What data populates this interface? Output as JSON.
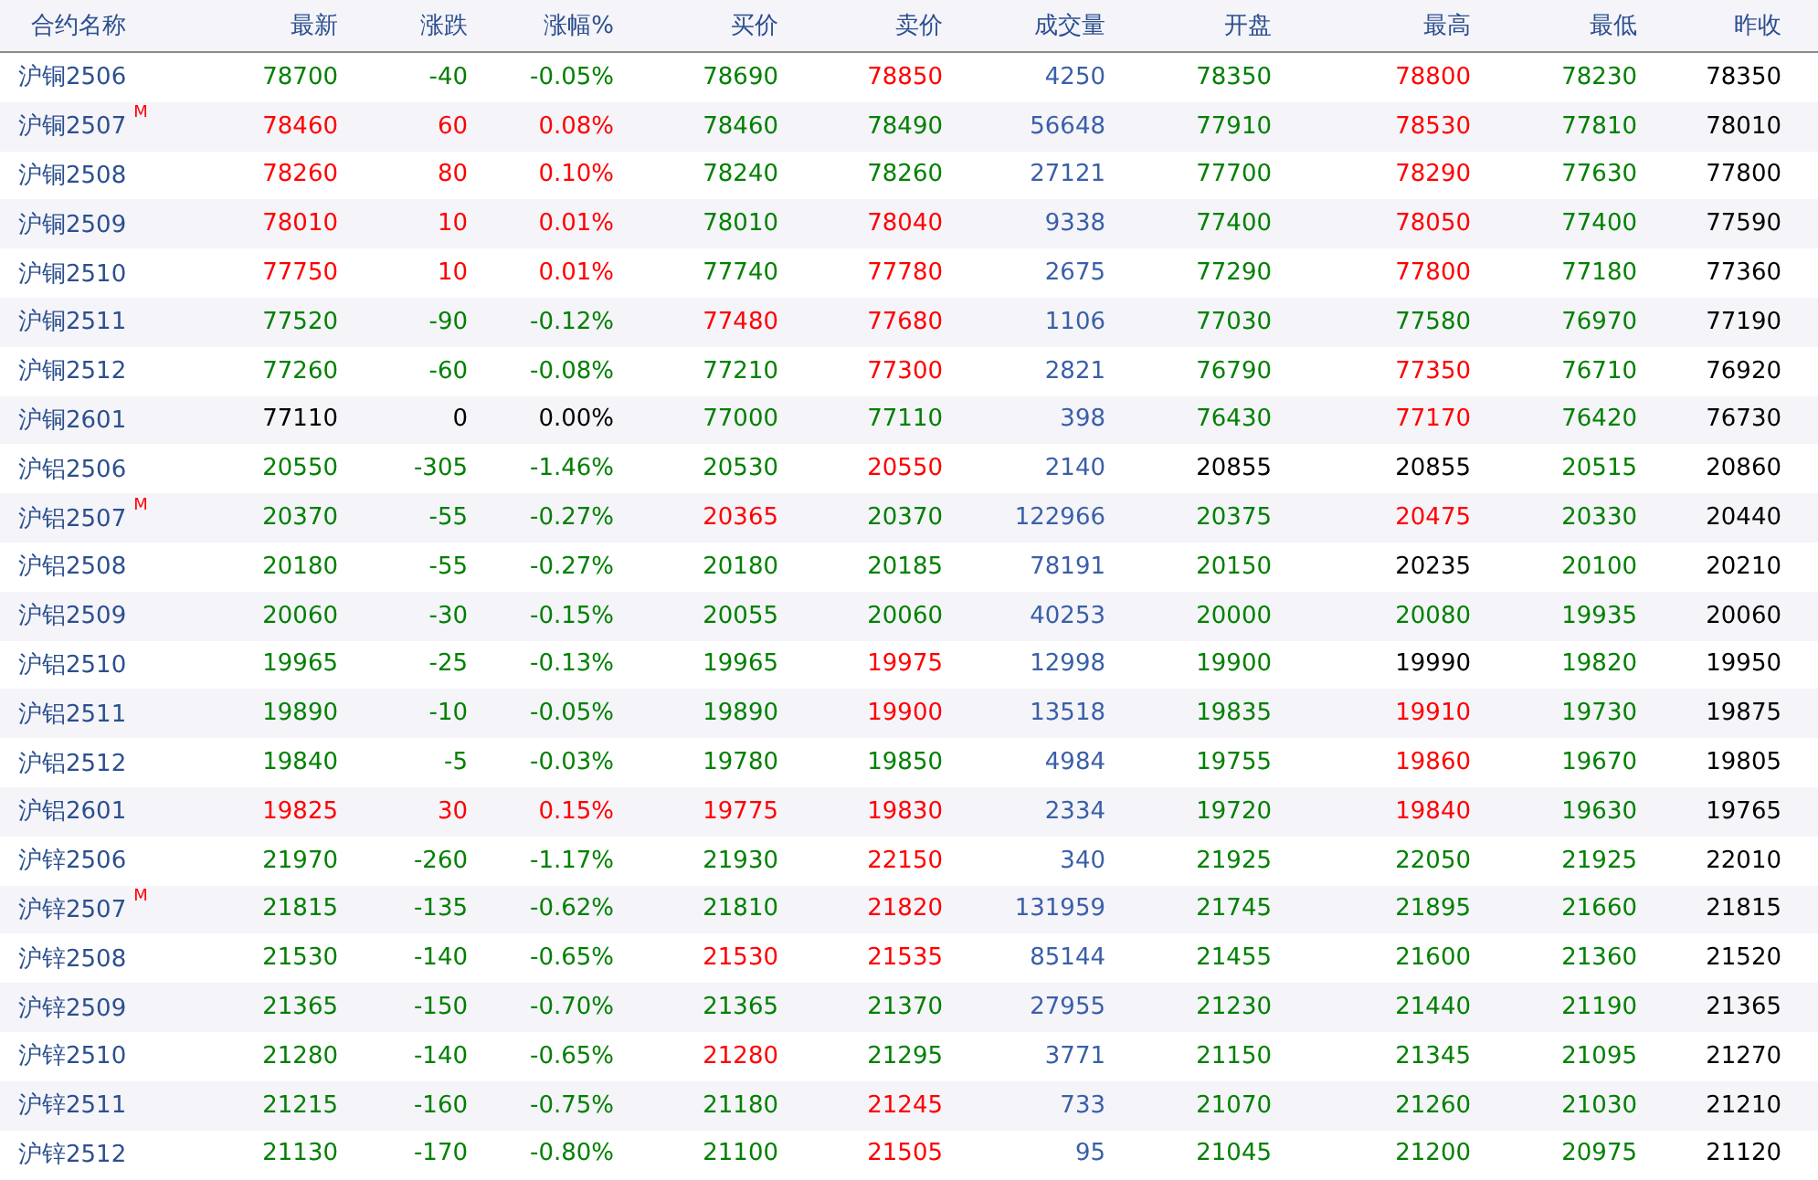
{
  "table": {
    "columns": [
      "合约名称",
      "最新",
      "涨跌",
      "涨幅%",
      "买价",
      "卖价",
      "成交量",
      "开盘",
      "最高",
      "最低",
      "昨收"
    ],
    "rows": [
      {
        "cells": [
          {
            "text": "沪铜2506"
          },
          {
            "text": "78700",
            "color": "#008000"
          },
          {
            "text": "-40",
            "color": "#008000"
          },
          {
            "text": "-0.05%",
            "color": "#008000"
          },
          {
            "text": "78690",
            "color": "#008000"
          },
          {
            "text": "78850",
            "color": "#ff0000"
          },
          {
            "text": "4250",
            "color": "#3a5fa8"
          },
          {
            "text": "78350",
            "color": "#008000"
          },
          {
            "text": "78800",
            "color": "#ff0000"
          },
          {
            "text": "78230",
            "color": "#008000"
          },
          {
            "text": "78350",
            "color": "#000000"
          }
        ]
      },
      {
        "cells": [
          {
            "text": "沪铜2507",
            "badge": "M"
          },
          {
            "text": "78460",
            "color": "#ff0000"
          },
          {
            "text": "60",
            "color": "#ff0000"
          },
          {
            "text": "0.08%",
            "color": "#ff0000"
          },
          {
            "text": "78460",
            "color": "#008000"
          },
          {
            "text": "78490",
            "color": "#008000"
          },
          {
            "text": "56648",
            "color": "#3a5fa8"
          },
          {
            "text": "77910",
            "color": "#008000"
          },
          {
            "text": "78530",
            "color": "#ff0000"
          },
          {
            "text": "77810",
            "color": "#008000"
          },
          {
            "text": "78010",
            "color": "#000000"
          }
        ]
      },
      {
        "cells": [
          {
            "text": "沪铜2508"
          },
          {
            "text": "78260",
            "color": "#ff0000"
          },
          {
            "text": "80",
            "color": "#ff0000"
          },
          {
            "text": "0.10%",
            "color": "#ff0000"
          },
          {
            "text": "78240",
            "color": "#008000"
          },
          {
            "text": "78260",
            "color": "#008000"
          },
          {
            "text": "27121",
            "color": "#3a5fa8"
          },
          {
            "text": "77700",
            "color": "#008000"
          },
          {
            "text": "78290",
            "color": "#ff0000"
          },
          {
            "text": "77630",
            "color": "#008000"
          },
          {
            "text": "77800",
            "color": "#000000"
          }
        ]
      },
      {
        "cells": [
          {
            "text": "沪铜2509"
          },
          {
            "text": "78010",
            "color": "#ff0000"
          },
          {
            "text": "10",
            "color": "#ff0000"
          },
          {
            "text": "0.01%",
            "color": "#ff0000"
          },
          {
            "text": "78010",
            "color": "#008000"
          },
          {
            "text": "78040",
            "color": "#ff0000"
          },
          {
            "text": "9338",
            "color": "#3a5fa8"
          },
          {
            "text": "77400",
            "color": "#008000"
          },
          {
            "text": "78050",
            "color": "#ff0000"
          },
          {
            "text": "77400",
            "color": "#008000"
          },
          {
            "text": "77590",
            "color": "#000000"
          }
        ]
      },
      {
        "cells": [
          {
            "text": "沪铜2510"
          },
          {
            "text": "77750",
            "color": "#ff0000"
          },
          {
            "text": "10",
            "color": "#ff0000"
          },
          {
            "text": "0.01%",
            "color": "#ff0000"
          },
          {
            "text": "77740",
            "color": "#008000"
          },
          {
            "text": "77780",
            "color": "#ff0000"
          },
          {
            "text": "2675",
            "color": "#3a5fa8"
          },
          {
            "text": "77290",
            "color": "#008000"
          },
          {
            "text": "77800",
            "color": "#ff0000"
          },
          {
            "text": "77180",
            "color": "#008000"
          },
          {
            "text": "77360",
            "color": "#000000"
          }
        ]
      },
      {
        "cells": [
          {
            "text": "沪铜2511"
          },
          {
            "text": "77520",
            "color": "#008000"
          },
          {
            "text": "-90",
            "color": "#008000"
          },
          {
            "text": "-0.12%",
            "color": "#008000"
          },
          {
            "text": "77480",
            "color": "#ff0000"
          },
          {
            "text": "77680",
            "color": "#ff0000"
          },
          {
            "text": "1106",
            "color": "#3a5fa8"
          },
          {
            "text": "77030",
            "color": "#008000"
          },
          {
            "text": "77580",
            "color": "#008000"
          },
          {
            "text": "76970",
            "color": "#008000"
          },
          {
            "text": "77190",
            "color": "#000000"
          }
        ]
      },
      {
        "cells": [
          {
            "text": "沪铜2512"
          },
          {
            "text": "77260",
            "color": "#008000"
          },
          {
            "text": "-60",
            "color": "#008000"
          },
          {
            "text": "-0.08%",
            "color": "#008000"
          },
          {
            "text": "77210",
            "color": "#008000"
          },
          {
            "text": "77300",
            "color": "#ff0000"
          },
          {
            "text": "2821",
            "color": "#3a5fa8"
          },
          {
            "text": "76790",
            "color": "#008000"
          },
          {
            "text": "77350",
            "color": "#ff0000"
          },
          {
            "text": "76710",
            "color": "#008000"
          },
          {
            "text": "76920",
            "color": "#000000"
          }
        ]
      },
      {
        "cells": [
          {
            "text": "沪铜2601"
          },
          {
            "text": "77110",
            "color": "#000000"
          },
          {
            "text": "0",
            "color": "#000000"
          },
          {
            "text": "0.00%",
            "color": "#000000"
          },
          {
            "text": "77000",
            "color": "#008000"
          },
          {
            "text": "77110",
            "color": "#008000"
          },
          {
            "text": "398",
            "color": "#3a5fa8"
          },
          {
            "text": "76430",
            "color": "#008000"
          },
          {
            "text": "77170",
            "color": "#ff0000"
          },
          {
            "text": "76420",
            "color": "#008000"
          },
          {
            "text": "76730",
            "color": "#000000"
          }
        ]
      },
      {
        "cells": [
          {
            "text": "沪铝2506"
          },
          {
            "text": "20550",
            "color": "#008000"
          },
          {
            "text": "-305",
            "color": "#008000"
          },
          {
            "text": "-1.46%",
            "color": "#008000"
          },
          {
            "text": "20530",
            "color": "#008000"
          },
          {
            "text": "20550",
            "color": "#ff0000"
          },
          {
            "text": "2140",
            "color": "#3a5fa8"
          },
          {
            "text": "20855",
            "color": "#000000"
          },
          {
            "text": "20855",
            "color": "#000000"
          },
          {
            "text": "20515",
            "color": "#008000"
          },
          {
            "text": "20860",
            "color": "#000000"
          }
        ]
      },
      {
        "cells": [
          {
            "text": "沪铝2507",
            "badge": "M"
          },
          {
            "text": "20370",
            "color": "#008000"
          },
          {
            "text": "-55",
            "color": "#008000"
          },
          {
            "text": "-0.27%",
            "color": "#008000"
          },
          {
            "text": "20365",
            "color": "#ff0000"
          },
          {
            "text": "20370",
            "color": "#008000"
          },
          {
            "text": "122966",
            "color": "#3a5fa8"
          },
          {
            "text": "20375",
            "color": "#008000"
          },
          {
            "text": "20475",
            "color": "#ff0000"
          },
          {
            "text": "20330",
            "color": "#008000"
          },
          {
            "text": "20440",
            "color": "#000000"
          }
        ]
      },
      {
        "cells": [
          {
            "text": "沪铝2508"
          },
          {
            "text": "20180",
            "color": "#008000"
          },
          {
            "text": "-55",
            "color": "#008000"
          },
          {
            "text": "-0.27%",
            "color": "#008000"
          },
          {
            "text": "20180",
            "color": "#008000"
          },
          {
            "text": "20185",
            "color": "#008000"
          },
          {
            "text": "78191",
            "color": "#3a5fa8"
          },
          {
            "text": "20150",
            "color": "#008000"
          },
          {
            "text": "20235",
            "color": "#000000"
          },
          {
            "text": "20100",
            "color": "#008000"
          },
          {
            "text": "20210",
            "color": "#000000"
          }
        ]
      },
      {
        "cells": [
          {
            "text": "沪铝2509"
          },
          {
            "text": "20060",
            "color": "#008000"
          },
          {
            "text": "-30",
            "color": "#008000"
          },
          {
            "text": "-0.15%",
            "color": "#008000"
          },
          {
            "text": "20055",
            "color": "#008000"
          },
          {
            "text": "20060",
            "color": "#008000"
          },
          {
            "text": "40253",
            "color": "#3a5fa8"
          },
          {
            "text": "20000",
            "color": "#008000"
          },
          {
            "text": "20080",
            "color": "#008000"
          },
          {
            "text": "19935",
            "color": "#008000"
          },
          {
            "text": "20060",
            "color": "#000000"
          }
        ]
      },
      {
        "cells": [
          {
            "text": "沪铝2510"
          },
          {
            "text": "19965",
            "color": "#008000"
          },
          {
            "text": "-25",
            "color": "#008000"
          },
          {
            "text": "-0.13%",
            "color": "#008000"
          },
          {
            "text": "19965",
            "color": "#008000"
          },
          {
            "text": "19975",
            "color": "#ff0000"
          },
          {
            "text": "12998",
            "color": "#3a5fa8"
          },
          {
            "text": "19900",
            "color": "#008000"
          },
          {
            "text": "19990",
            "color": "#000000"
          },
          {
            "text": "19820",
            "color": "#008000"
          },
          {
            "text": "19950",
            "color": "#000000"
          }
        ]
      },
      {
        "cells": [
          {
            "text": "沪铝2511"
          },
          {
            "text": "19890",
            "color": "#008000"
          },
          {
            "text": "-10",
            "color": "#008000"
          },
          {
            "text": "-0.05%",
            "color": "#008000"
          },
          {
            "text": "19890",
            "color": "#008000"
          },
          {
            "text": "19900",
            "color": "#ff0000"
          },
          {
            "text": "13518",
            "color": "#3a5fa8"
          },
          {
            "text": "19835",
            "color": "#008000"
          },
          {
            "text": "19910",
            "color": "#ff0000"
          },
          {
            "text": "19730",
            "color": "#008000"
          },
          {
            "text": "19875",
            "color": "#000000"
          }
        ]
      },
      {
        "cells": [
          {
            "text": "沪铝2512"
          },
          {
            "text": "19840",
            "color": "#008000"
          },
          {
            "text": "-5",
            "color": "#008000"
          },
          {
            "text": "-0.03%",
            "color": "#008000"
          },
          {
            "text": "19780",
            "color": "#008000"
          },
          {
            "text": "19850",
            "color": "#008000"
          },
          {
            "text": "4984",
            "color": "#3a5fa8"
          },
          {
            "text": "19755",
            "color": "#008000"
          },
          {
            "text": "19860",
            "color": "#ff0000"
          },
          {
            "text": "19670",
            "color": "#008000"
          },
          {
            "text": "19805",
            "color": "#000000"
          }
        ]
      },
      {
        "cells": [
          {
            "text": "沪铝2601"
          },
          {
            "text": "19825",
            "color": "#ff0000"
          },
          {
            "text": "30",
            "color": "#ff0000"
          },
          {
            "text": "0.15%",
            "color": "#ff0000"
          },
          {
            "text": "19775",
            "color": "#ff0000"
          },
          {
            "text": "19830",
            "color": "#ff0000"
          },
          {
            "text": "2334",
            "color": "#3a5fa8"
          },
          {
            "text": "19720",
            "color": "#008000"
          },
          {
            "text": "19840",
            "color": "#ff0000"
          },
          {
            "text": "19630",
            "color": "#008000"
          },
          {
            "text": "19765",
            "color": "#000000"
          }
        ]
      },
      {
        "cells": [
          {
            "text": "沪锌2506"
          },
          {
            "text": "21970",
            "color": "#008000"
          },
          {
            "text": "-260",
            "color": "#008000"
          },
          {
            "text": "-1.17%",
            "color": "#008000"
          },
          {
            "text": "21930",
            "color": "#008000"
          },
          {
            "text": "22150",
            "color": "#ff0000"
          },
          {
            "text": "340",
            "color": "#3a5fa8"
          },
          {
            "text": "21925",
            "color": "#008000"
          },
          {
            "text": "22050",
            "color": "#008000"
          },
          {
            "text": "21925",
            "color": "#008000"
          },
          {
            "text": "22010",
            "color": "#000000"
          }
        ]
      },
      {
        "cells": [
          {
            "text": "沪锌2507",
            "badge": "M"
          },
          {
            "text": "21815",
            "color": "#008000"
          },
          {
            "text": "-135",
            "color": "#008000"
          },
          {
            "text": "-0.62%",
            "color": "#008000"
          },
          {
            "text": "21810",
            "color": "#008000"
          },
          {
            "text": "21820",
            "color": "#ff0000"
          },
          {
            "text": "131959",
            "color": "#3a5fa8"
          },
          {
            "text": "21745",
            "color": "#008000"
          },
          {
            "text": "21895",
            "color": "#008000"
          },
          {
            "text": "21660",
            "color": "#008000"
          },
          {
            "text": "21815",
            "color": "#000000"
          }
        ]
      },
      {
        "cells": [
          {
            "text": "沪锌2508"
          },
          {
            "text": "21530",
            "color": "#008000"
          },
          {
            "text": "-140",
            "color": "#008000"
          },
          {
            "text": "-0.65%",
            "color": "#008000"
          },
          {
            "text": "21530",
            "color": "#ff0000"
          },
          {
            "text": "21535",
            "color": "#ff0000"
          },
          {
            "text": "85144",
            "color": "#3a5fa8"
          },
          {
            "text": "21455",
            "color": "#008000"
          },
          {
            "text": "21600",
            "color": "#008000"
          },
          {
            "text": "21360",
            "color": "#008000"
          },
          {
            "text": "21520",
            "color": "#000000"
          }
        ]
      },
      {
        "cells": [
          {
            "text": "沪锌2509"
          },
          {
            "text": "21365",
            "color": "#008000"
          },
          {
            "text": "-150",
            "color": "#008000"
          },
          {
            "text": "-0.70%",
            "color": "#008000"
          },
          {
            "text": "21365",
            "color": "#008000"
          },
          {
            "text": "21370",
            "color": "#008000"
          },
          {
            "text": "27955",
            "color": "#3a5fa8"
          },
          {
            "text": "21230",
            "color": "#008000"
          },
          {
            "text": "21440",
            "color": "#008000"
          },
          {
            "text": "21190",
            "color": "#008000"
          },
          {
            "text": "21365",
            "color": "#000000"
          }
        ]
      },
      {
        "cells": [
          {
            "text": "沪锌2510"
          },
          {
            "text": "21280",
            "color": "#008000"
          },
          {
            "text": "-140",
            "color": "#008000"
          },
          {
            "text": "-0.65%",
            "color": "#008000"
          },
          {
            "text": "21280",
            "color": "#ff0000"
          },
          {
            "text": "21295",
            "color": "#008000"
          },
          {
            "text": "3771",
            "color": "#3a5fa8"
          },
          {
            "text": "21150",
            "color": "#008000"
          },
          {
            "text": "21345",
            "color": "#008000"
          },
          {
            "text": "21095",
            "color": "#008000"
          },
          {
            "text": "21270",
            "color": "#000000"
          }
        ]
      },
      {
        "cells": [
          {
            "text": "沪锌2511"
          },
          {
            "text": "21215",
            "color": "#008000"
          },
          {
            "text": "-160",
            "color": "#008000"
          },
          {
            "text": "-0.75%",
            "color": "#008000"
          },
          {
            "text": "21180",
            "color": "#008000"
          },
          {
            "text": "21245",
            "color": "#ff0000"
          },
          {
            "text": "733",
            "color": "#3a5fa8"
          },
          {
            "text": "21070",
            "color": "#008000"
          },
          {
            "text": "21260",
            "color": "#008000"
          },
          {
            "text": "21030",
            "color": "#008000"
          },
          {
            "text": "21210",
            "color": "#000000"
          }
        ]
      },
      {
        "cells": [
          {
            "text": "沪锌2512"
          },
          {
            "text": "21130",
            "color": "#008000"
          },
          {
            "text": "-170",
            "color": "#008000"
          },
          {
            "text": "-0.80%",
            "color": "#008000"
          },
          {
            "text": "21100",
            "color": "#008000"
          },
          {
            "text": "21505",
            "color": "#ff0000"
          },
          {
            "text": "95",
            "color": "#3a5fa8"
          },
          {
            "text": "21045",
            "color": "#008000"
          },
          {
            "text": "21200",
            "color": "#008000"
          },
          {
            "text": "20975",
            "color": "#008000"
          },
          {
            "text": "21120",
            "color": "#000000"
          }
        ]
      }
    ]
  }
}
